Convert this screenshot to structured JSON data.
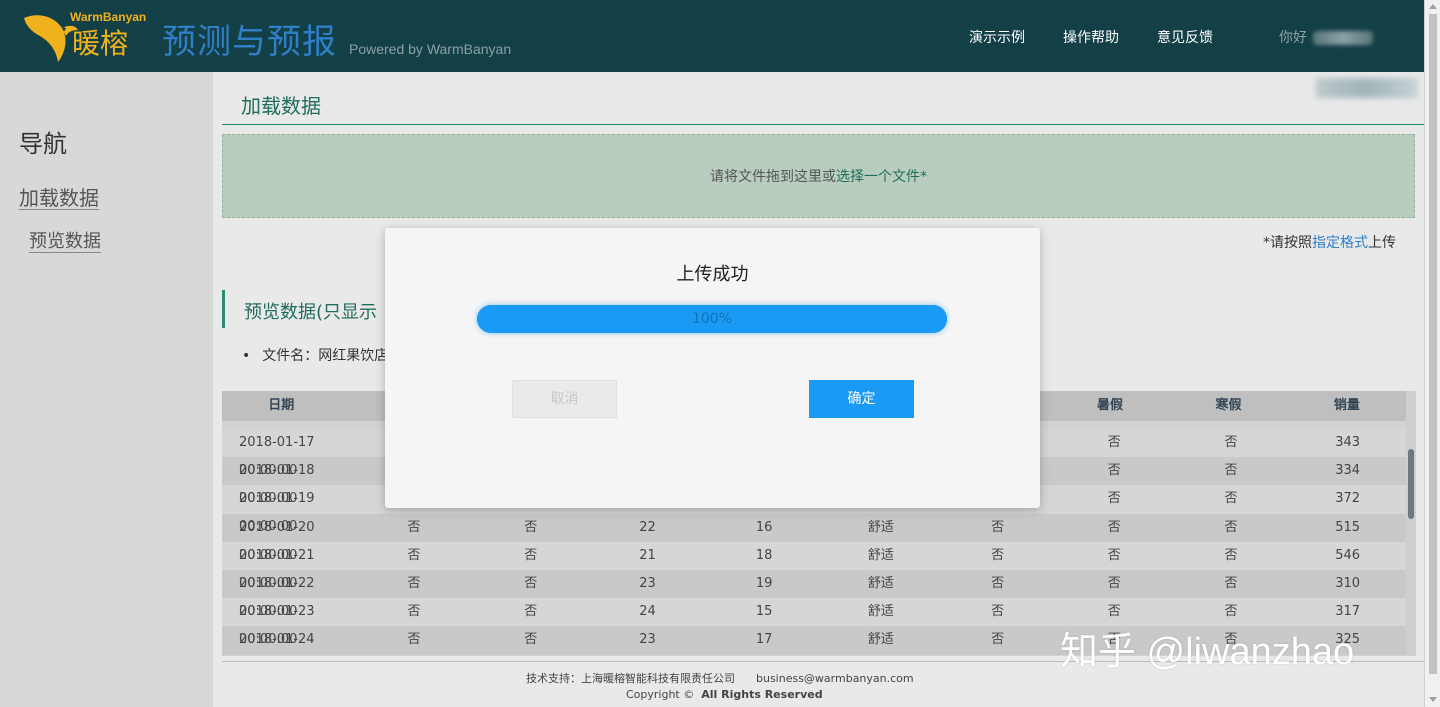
{
  "header": {
    "brand_en": "WarmBanyan",
    "brand_cn": "暖榕",
    "app_title": "预测与预报",
    "powered_by": "Powered by WarmBanyan",
    "nav": {
      "demo": "演示示例",
      "help": "操作帮助",
      "feedback": "意见反馈"
    },
    "greeting": "你好"
  },
  "sidebar": {
    "title": "导航",
    "items": [
      {
        "label": "加载数据"
      },
      {
        "label": "预览数据"
      }
    ]
  },
  "load_section": {
    "title": "加载数据",
    "drop_text": "请将文件拖到这里或",
    "drop_link": "选择一个文件*",
    "note_prefix": "*请按照",
    "note_link": "指定格式",
    "note_suffix": "上传"
  },
  "preview_section": {
    "title": "预览数据(只显示",
    "filename": "文件名：网红果饮店"
  },
  "table": {
    "headers": [
      "日期",
      "",
      "",
      "",
      "",
      "",
      "",
      "暑假",
      "寒假",
      "销量"
    ],
    "rows": [
      [
        "2018-01-17 00:00:00",
        "",
        "",
        "",
        "",
        "",
        "",
        "否",
        "否",
        "343"
      ],
      [
        "2018-01-18 00:00:00",
        "",
        "",
        "",
        "",
        "",
        "",
        "否",
        "否",
        "334"
      ],
      [
        "2018-01-19 00:00:00",
        "",
        "",
        "",
        "",
        "",
        "",
        "否",
        "否",
        "372"
      ],
      [
        "2018-01-20 00:00:00",
        "否",
        "否",
        "22",
        "16",
        "舒适",
        "否",
        "否",
        "否",
        "515"
      ],
      [
        "2018-01-21 00:00:00",
        "否",
        "否",
        "21",
        "18",
        "舒适",
        "否",
        "否",
        "否",
        "546"
      ],
      [
        "2018-01-22 00:00:00",
        "否",
        "否",
        "23",
        "19",
        "舒适",
        "否",
        "否",
        "否",
        "310"
      ],
      [
        "2018-01-23 00:00:00",
        "否",
        "否",
        "24",
        "15",
        "舒适",
        "否",
        "否",
        "否",
        "317"
      ],
      [
        "2018-01-24 00:00:00",
        "否",
        "否",
        "23",
        "17",
        "舒适",
        "否",
        "否",
        "否",
        "325"
      ]
    ]
  },
  "footer": {
    "support": "技术支持：上海暖榕智能科技有限责任公司",
    "email": "business@warmbanyan.com",
    "copyright": "Copyright ©",
    "rights": "All Rights Reserved"
  },
  "modal": {
    "title": "上传成功",
    "progress_percent": 100,
    "progress_label": "100%",
    "cancel_label": "取消",
    "ok_label": "确定"
  },
  "watermark": "知乎 @liwanzhao",
  "colors": {
    "header_bg": "#133f47",
    "brand": "#f0b21c",
    "title_blue": "#2f7fc6",
    "accent_green": "#1f6e5c",
    "primary": "#1a9af5"
  }
}
